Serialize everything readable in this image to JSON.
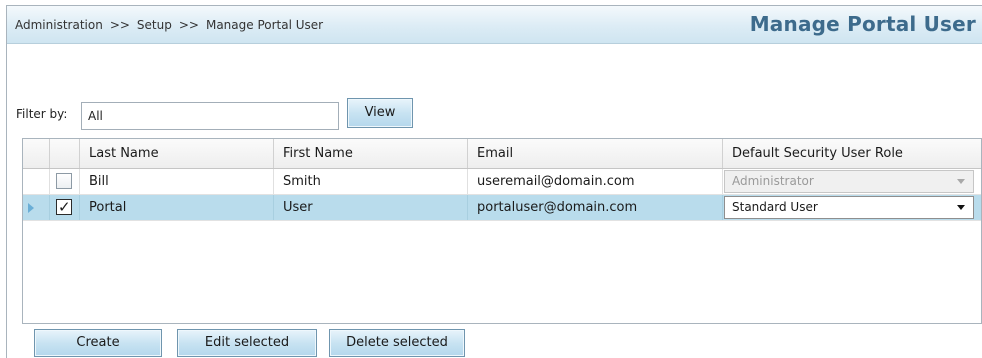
{
  "header": {
    "breadcrumb": [
      "Administration",
      "Setup",
      "Manage Portal User"
    ],
    "separator": ">>",
    "title": "Manage Portal User"
  },
  "filter": {
    "label": "Filter by:",
    "value": "All",
    "view_button": "View"
  },
  "grid": {
    "columns": [
      "Last Name",
      "First Name",
      "Email",
      "Default Security User Role"
    ],
    "rows": [
      {
        "checked": false,
        "selected": false,
        "last_name": "Bill",
        "first_name": "Smith",
        "email": "useremail@domain.com",
        "role": "Administrator",
        "role_enabled": false
      },
      {
        "checked": true,
        "selected": true,
        "last_name": "Portal",
        "first_name": "User",
        "email": "portaluser@domain.com",
        "role": "Standard User",
        "role_enabled": true
      }
    ]
  },
  "actions": {
    "create": "Create",
    "edit": "Edit selected",
    "delete": "Delete selected"
  },
  "colors": {
    "title": "#3d6b8c",
    "selected_row": "#b9dcec",
    "button_border": "#6f95ae"
  },
  "icons": {
    "check": "✓",
    "row_indicator": "triangle-right-icon",
    "dropdown": "chevron-down-icon"
  }
}
